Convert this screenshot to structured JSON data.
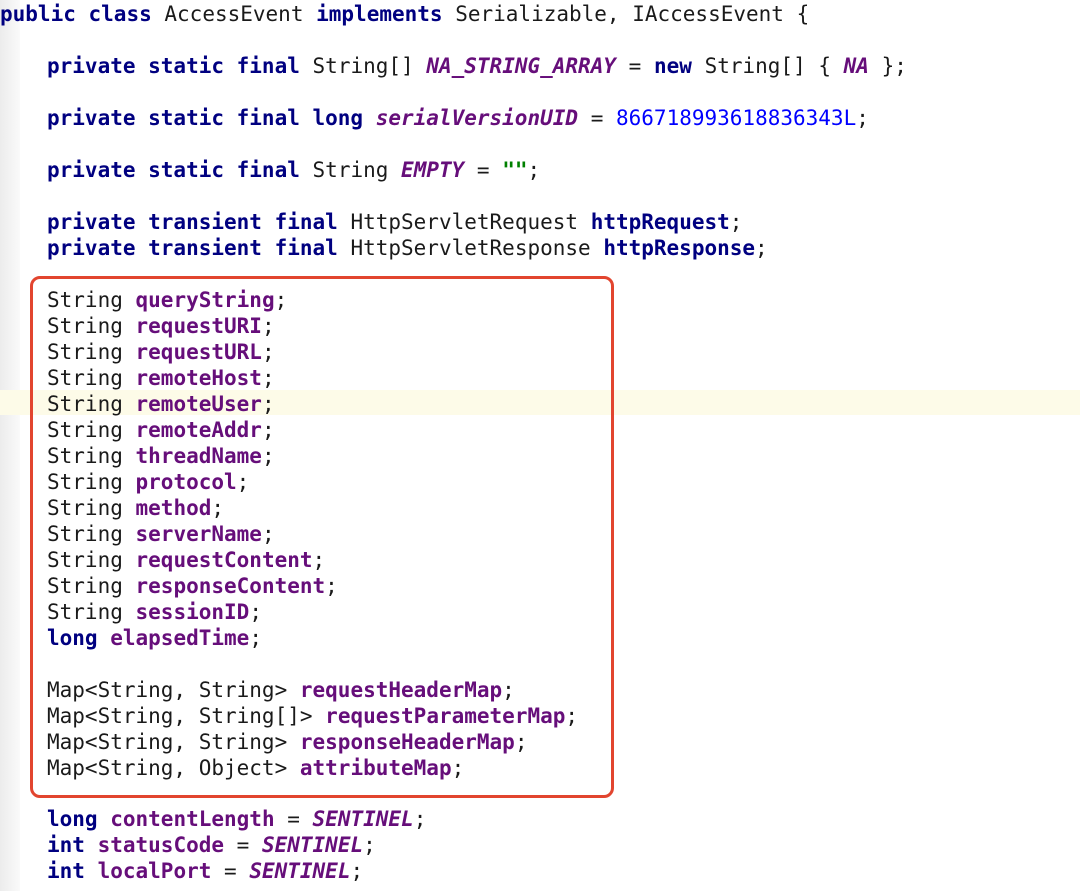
{
  "editor": {
    "class_decl": {
      "kw1": "public",
      "kw2": "class",
      "name": "AccessEvent",
      "kw3": "implements",
      "ifaces": "Serializable, IAccessEvent {"
    },
    "l1": {
      "mods": "private static final",
      "type": "String[]",
      "name": "NA_STRING_ARRAY",
      "eq": "=",
      "kw": "new",
      "rest1": "String[] {",
      "na": "NA",
      "rest2": "};"
    },
    "l2": {
      "mods": "private static final long",
      "name": "serialVersionUID",
      "eq": "=",
      "value": "866718993618836343L",
      ";": ";"
    },
    "l3": {
      "mods": "private static final",
      "type": "String",
      "name": "EMPTY",
      "eq": "=",
      "value": "\"\""
    },
    "l4": {
      "mods": "private transient final",
      "type": "HttpServletRequest",
      "name": "httpRequest"
    },
    "l5": {
      "mods": "private transient final",
      "type": "HttpServletResponse",
      "name": "httpResponse"
    },
    "boxed_fields": [
      {
        "type": "String",
        "name": "queryString"
      },
      {
        "type": "String",
        "name": "requestURI"
      },
      {
        "type": "String",
        "name": "requestURL"
      },
      {
        "type": "String",
        "name": "remoteHost"
      },
      {
        "type": "String",
        "name": "remoteUser"
      },
      {
        "type": "String",
        "name": "remoteAddr"
      },
      {
        "type": "String",
        "name": "threadName"
      },
      {
        "type": "String",
        "name": "protocol"
      },
      {
        "type": "String",
        "name": "method"
      },
      {
        "type": "String",
        "name": "serverName"
      },
      {
        "type": "String",
        "name": "requestContent"
      },
      {
        "type": "String",
        "name": "responseContent"
      },
      {
        "type": "String",
        "name": "sessionID"
      },
      {
        "type": "long",
        "name": "elapsedTime",
        "kw": true
      }
    ],
    "map_fields": [
      {
        "type": "Map<String, String>",
        "name": "requestHeaderMap"
      },
      {
        "type": "Map<String, String[]>",
        "name": "requestParameterMap"
      },
      {
        "type": "Map<String, String>",
        "name": "responseHeaderMap"
      },
      {
        "type": "Map<String, Object>",
        "name": "attributeMap"
      }
    ],
    "sentinel_fields": [
      {
        "type": "long",
        "name": "contentLength",
        "value": "SENTINEL"
      },
      {
        "type": "int",
        "name": "statusCode",
        "value": "SENTINEL"
      },
      {
        "type": "int",
        "name": "localPort",
        "value": "SENTINEL"
      }
    ]
  }
}
